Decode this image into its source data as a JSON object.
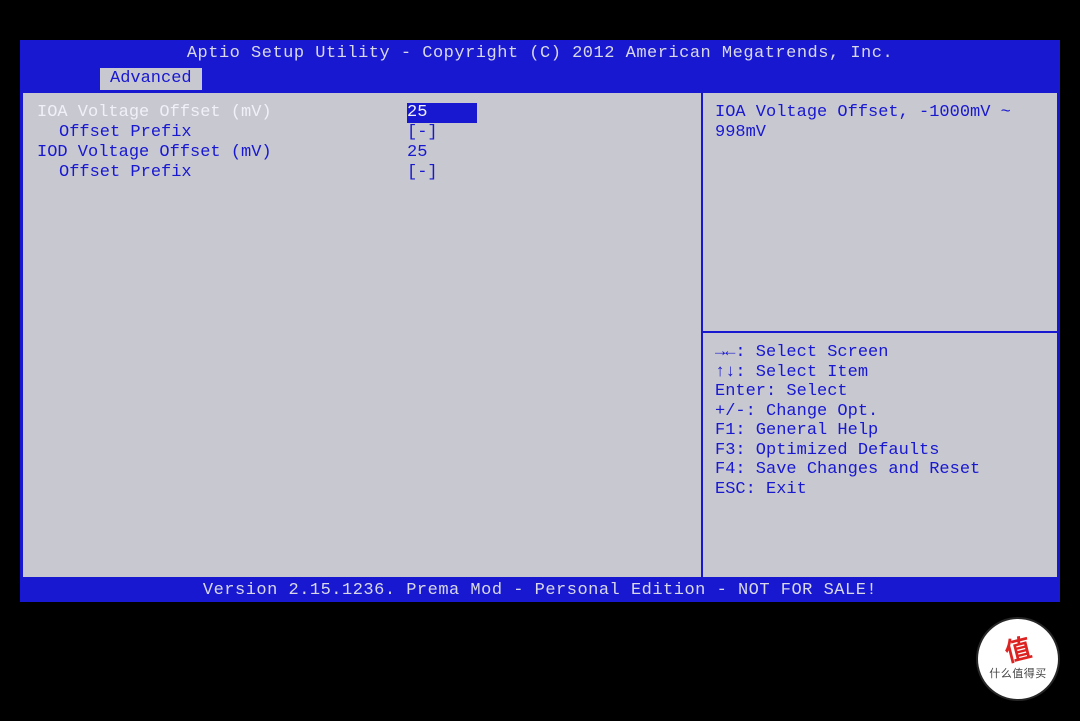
{
  "header": {
    "title": "Aptio Setup Utility - Copyright (C) 2012 American Megatrends, Inc.",
    "active_tab": "Advanced"
  },
  "settings": [
    {
      "label": "IOA Voltage Offset (mV)",
      "value": "25",
      "indent": false,
      "selected": true
    },
    {
      "label": "Offset Prefix",
      "value": "[-]",
      "indent": true,
      "selected": false
    },
    {
      "label": "IOD Voltage Offset (mV)",
      "value": "25",
      "indent": false,
      "selected": false
    },
    {
      "label": "Offset Prefix",
      "value": "[-]",
      "indent": true,
      "selected": false
    }
  ],
  "help": {
    "description": "IOA Voltage Offset, -1000mV ~ 998mV",
    "keys": [
      "→←: Select Screen",
      "↑↓: Select Item",
      "Enter: Select",
      "+/-: Change Opt.",
      "F1: General Help",
      "F3: Optimized Defaults",
      "F4: Save Changes and Reset",
      "ESC: Exit"
    ]
  },
  "footer": "Version 2.15.1236. Prema Mod - Personal Edition - NOT FOR SALE!",
  "watermark": {
    "main": "值",
    "sub": "什么值得买"
  }
}
